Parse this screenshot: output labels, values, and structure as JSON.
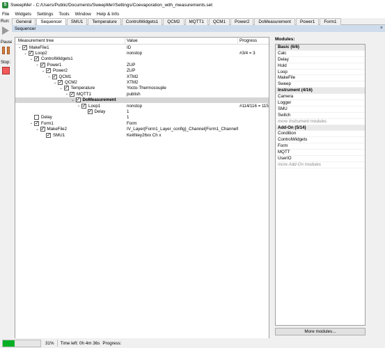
{
  "window": {
    "title": "SweepMe! - C:/Users/Public/Documents/SweepMe!/Settings/Coevaporation_with_measurements.set"
  },
  "menu": [
    "File",
    "Widgets",
    "Settings",
    "Tools",
    "Window",
    "Help & Info"
  ],
  "leftbar": {
    "run_label": "Run:",
    "pause_label": "Pause:",
    "stop_label": "Stop:"
  },
  "tabs": [
    "General",
    "Sequencer",
    "SMU1",
    "Temperature",
    "ControlWidgets1",
    "QCM2",
    "MQTT1",
    "QCM1",
    "Power2",
    "DoMeasurement",
    "Power1",
    "Form1"
  ],
  "active_tab": "Sequencer",
  "panel": {
    "title": "Sequencer",
    "close_glyph": "×"
  },
  "tree": {
    "headers": [
      "Measurement tree",
      "Value",
      "Progress"
    ],
    "rows": [
      {
        "label": "MakeFile1",
        "value": "ID",
        "progress": "",
        "depth": 0,
        "expanded": true,
        "checked": true
      },
      {
        "label": "Loop2",
        "value": "nonstop",
        "progress": "#3/4 = 3",
        "depth": 1,
        "expanded": true,
        "checked": true
      },
      {
        "label": "ControlWidgets1",
        "value": "",
        "progress": "",
        "depth": 2,
        "expanded": true,
        "checked": true
      },
      {
        "label": "Power1",
        "value": "ZUP",
        "progress": "",
        "depth": 3,
        "expanded": true,
        "checked": true
      },
      {
        "label": "Power2",
        "value": "ZUP",
        "progress": "",
        "depth": 4,
        "expanded": true,
        "checked": true
      },
      {
        "label": "QCM1",
        "value": "XTM2",
        "progress": "",
        "depth": 5,
        "expanded": true,
        "checked": true
      },
      {
        "label": "QCM2",
        "value": "XTM2",
        "progress": "",
        "depth": 6,
        "expanded": true,
        "checked": true
      },
      {
        "label": "Temperature",
        "value": "Yocto-Thermocouple",
        "progress": "",
        "depth": 7,
        "expanded": true,
        "checked": true
      },
      {
        "label": "MQTT1",
        "value": "publish",
        "progress": "",
        "depth": 8,
        "expanded": true,
        "checked": true
      },
      {
        "label": "DoMeasurement",
        "value": "",
        "progress": "",
        "depth": 9,
        "expanded": true,
        "checked": true,
        "selected": true
      },
      {
        "label": "Loop1",
        "value": "nonstop",
        "progress": "#114/116 = 115",
        "depth": 10,
        "expanded": true,
        "checked": true
      },
      {
        "label": "Delay",
        "value": "1",
        "progress": "",
        "depth": 11,
        "expanded": false,
        "checked": true
      },
      {
        "label": "Delay",
        "value": "1",
        "progress": "",
        "depth": 2,
        "expanded": false,
        "checked": false
      },
      {
        "label": "Form1",
        "value": "Form",
        "progress": "",
        "depth": 2,
        "expanded": true,
        "checked": true
      },
      {
        "label": "MakeFile2",
        "value": "IV_Layer{Form1_Layer_config}_Channel{Form1_ChannelNo}",
        "progress": "",
        "depth": 3,
        "expanded": true,
        "checked": true
      },
      {
        "label": "SMU1",
        "value": "Keithley26xx Ch x",
        "progress": "",
        "depth": 4,
        "expanded": false,
        "checked": true
      }
    ]
  },
  "modules": {
    "title": "Modules:",
    "items": [
      {
        "label": "Basic (6/6)",
        "kind": "header"
      },
      {
        "label": "Calc",
        "kind": "item"
      },
      {
        "label": "Delay",
        "kind": "item"
      },
      {
        "label": "Hold",
        "kind": "item"
      },
      {
        "label": "Loop",
        "kind": "item"
      },
      {
        "label": "MakeFile",
        "kind": "item"
      },
      {
        "label": "Sweep",
        "kind": "item"
      },
      {
        "label": "Instrument (4/16)",
        "kind": "header"
      },
      {
        "label": "Camera",
        "kind": "item"
      },
      {
        "label": "Logger",
        "kind": "item"
      },
      {
        "label": "SMU",
        "kind": "item"
      },
      {
        "label": "Switch",
        "kind": "item"
      },
      {
        "label": "more Instrument modules",
        "kind": "more"
      },
      {
        "label": "Add-On (5/14)",
        "kind": "header"
      },
      {
        "label": "Condition",
        "kind": "item"
      },
      {
        "label": "ControlWidgets",
        "kind": "item"
      },
      {
        "label": "Form",
        "kind": "item"
      },
      {
        "label": "MQTT",
        "kind": "item"
      },
      {
        "label": "UserIO",
        "kind": "item"
      },
      {
        "label": "more Add-On modules",
        "kind": "more"
      }
    ],
    "more_button": "More modules..."
  },
  "status": {
    "progress_fraction": 0.31,
    "percent_text": "31%",
    "time_left": "Time left: 0h 4m 36s",
    "progress_label": "Progress:"
  },
  "colors": {
    "progress_fill": "#06b025",
    "panel_header": "#cfdcec",
    "stop": "#f05a5a",
    "pause": "#d5813a"
  }
}
